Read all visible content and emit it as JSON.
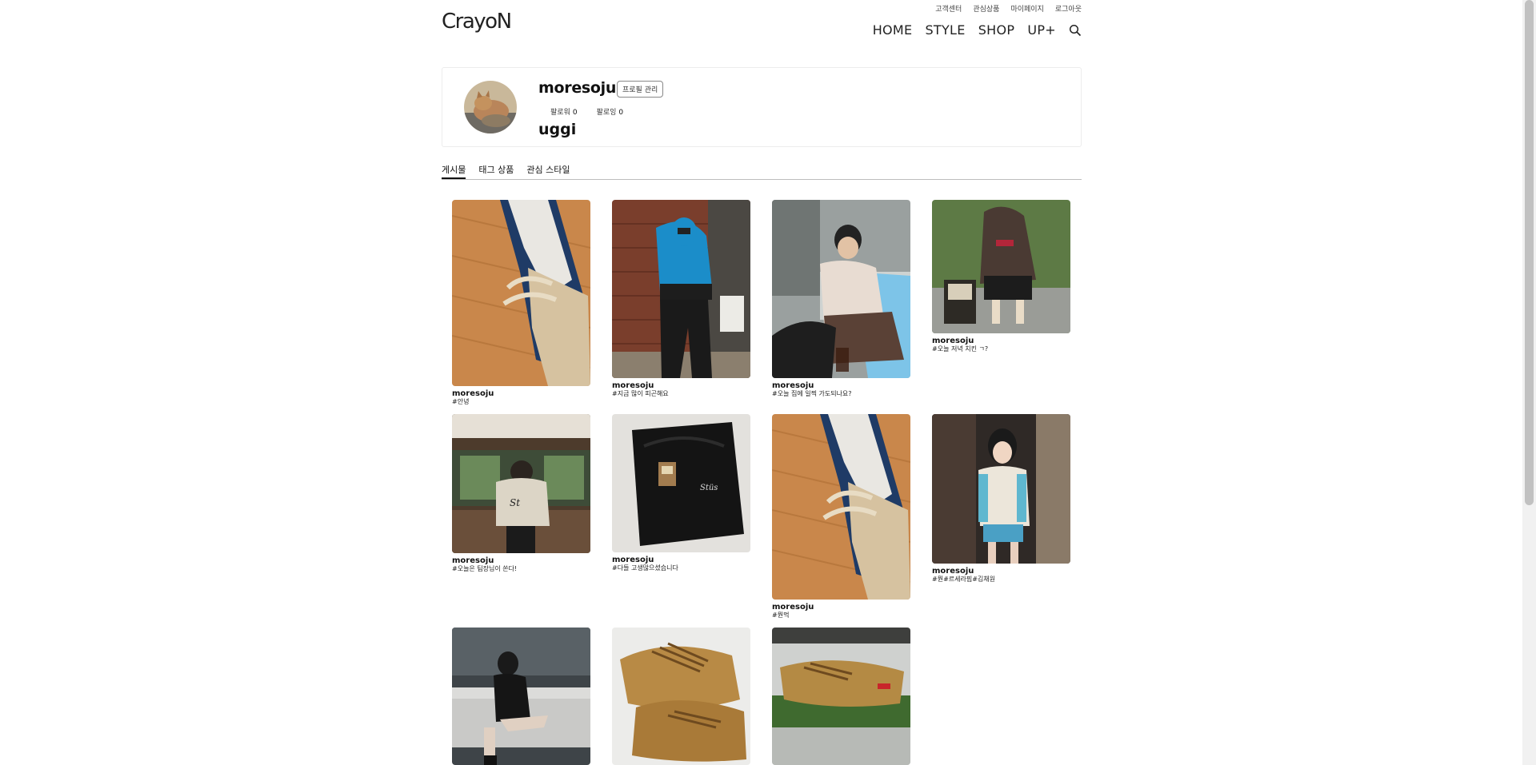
{
  "header": {
    "logo": "CrayoN",
    "top_links": [
      "고객센터",
      "관심상품",
      "마이페이지",
      "로그아웃"
    ],
    "nav": [
      "HOME",
      "STYLE",
      "SHOP",
      "UP+"
    ]
  },
  "profile": {
    "username": "moresoju",
    "manage_label": "프로필 관리",
    "follower_label": "팔로워",
    "follower_count": "0",
    "following_label": "팔로잉",
    "following_count": "0",
    "nickname": "uggi"
  },
  "tabs": [
    "게시물",
    "태그 상품",
    "관심 스타일"
  ],
  "posts": [
    {
      "user": "moresoju",
      "tag": "#안녕"
    },
    {
      "user": "moresoju",
      "tag": "#지금 많이 피곤해요"
    },
    {
      "user": "moresoju",
      "tag": "#오늘 집에 일찍 가도되나요?"
    },
    {
      "user": "moresoju",
      "tag": "#오늘 저녁 치킨 ㄱ?"
    },
    {
      "user": "moresoju",
      "tag": "#오늘은 팀장님이 쏜다!"
    },
    {
      "user": "moresoju",
      "tag": "#다들 고생많으셨습니다"
    },
    {
      "user": "moresoju",
      "tag": "#뭔먹"
    },
    {
      "user": "moresoju",
      "tag": "#뭔#르세라핌#김채원"
    }
  ],
  "colors": {
    "accent": "#111111",
    "border": "#ececec"
  }
}
